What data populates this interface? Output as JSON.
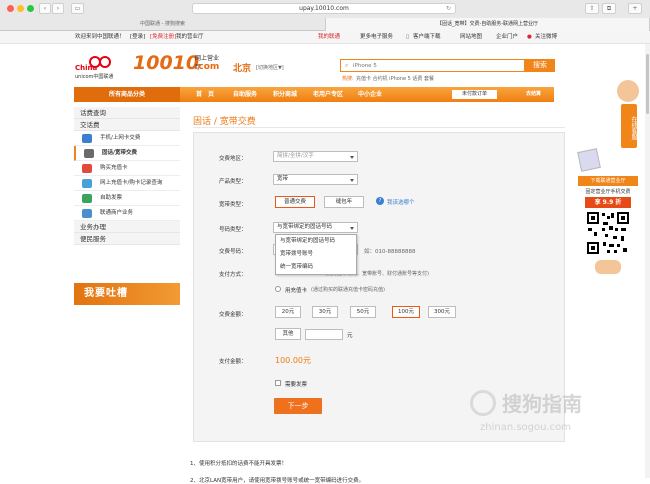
{
  "browser": {
    "url": "upay.10010.com",
    "tabs": [
      {
        "label": "中国联通 - 搜狗搜索",
        "active": false
      },
      {
        "label": "【固话_宽带】交费-自助服务-联通网上营业厅",
        "active": true
      }
    ]
  },
  "topbar": {
    "welcome": "欢迎来到中国联通！",
    "login": "[登录]",
    "register": "[免费注册]",
    "my_office": "我的营业厅",
    "my_unicom": "我的联通",
    "more_products": "更多电子服务",
    "client_download": "客户端下载",
    "site_map": "网站地图",
    "enterprise": "企业门户",
    "weibo": "关注微博"
  },
  "header": {
    "brand_cn": "China",
    "brand_sub": "unicom中国联通",
    "logo_number": "10010",
    "logo_dot": ".com",
    "logo_tag": "网上营业厅",
    "city": "北京",
    "city_switch": "[切换地区▼]",
    "search_placeholder": "iPhone 5",
    "search_button": "搜索",
    "hot_label": "热搜:",
    "hot_words": "充值卡  合约机  iPhone 5  话费  套餐"
  },
  "nav": {
    "all_categories": "所有商品分类",
    "items": [
      "首　页",
      "自助服务",
      "积分商城",
      "老用户专区",
      "中小企业"
    ],
    "order_status": "未付款订单",
    "cart": "去结算"
  },
  "sidebar": {
    "groups": [
      {
        "title": "话费查询",
        "items": []
      },
      {
        "title": "交话费",
        "items": [
          {
            "label": "手机/上网卡交费",
            "color": "#3a7fd0"
          },
          {
            "label": "固话/宽带交费",
            "color": "#6a6a6a",
            "selected": true
          },
          {
            "label": "购买充值卡",
            "color": "#e04b3a"
          },
          {
            "label": "网上充值卡/购卡记录查询",
            "color": "#4aa0d8"
          },
          {
            "label": "自助发票",
            "color": "#3aa55a"
          },
          {
            "label": "联通商户业务",
            "color": "#4a90d0"
          }
        ]
      },
      {
        "title": "业务办理",
        "items": []
      },
      {
        "title": "便民服务",
        "items": []
      }
    ],
    "complain_banner": "我要吐槽"
  },
  "main": {
    "title": "固话 / 宽带交费",
    "region_label": "交费地区：",
    "region_placeholder": "简拼/全拼/汉字",
    "product_label": "产品类型：",
    "product_value": "宽带",
    "bb_label": "宽带类型：",
    "bb_options": [
      "普通交费",
      "缝包年"
    ],
    "bb_help": "我该选哪个",
    "number_type_label": "号码类型：",
    "number_type_value": "与宽带绑定的固话号码",
    "number_type_options": [
      "与宽带绑定的固话号码",
      "宽带拨号账号",
      "统一宽带编码"
    ],
    "pay_number_label": "交费号码：",
    "pay_number_hint": "如：010-88888888",
    "pay_method_label": "支付方式：",
    "pay_method_hint": "(支持宽带号码、宽带账号、财付通账号等支付)",
    "recharge_card": "用充值卡",
    "recharge_card_hint": "(通过购买的联通充值卡密码充值)",
    "amount_label": "交费金额：",
    "amounts": [
      "20元",
      "30元",
      "50元",
      "100元",
      "300元"
    ],
    "amount_selected_index": 3,
    "other_label": "其他",
    "yuan": "元",
    "total_label": "支付金额：",
    "total_value": "100.00元",
    "invoice_label": "需要发票",
    "next_button": "下一步"
  },
  "notes": {
    "note1": "1、使用积分抵扣的话费不能开具发票！",
    "note2": "2、北京LAN宽带用户，请使用宽带拨号账号或统一宽带编码进行交费。"
  },
  "right_ad": {
    "online": "在线客服",
    "download": "下载联通营业厅",
    "app_text": "固定营业厅手机交费",
    "price": "享 9.9 折"
  },
  "watermark": {
    "cn": "搜狗指南",
    "en": "zhinan.sogou.com"
  }
}
